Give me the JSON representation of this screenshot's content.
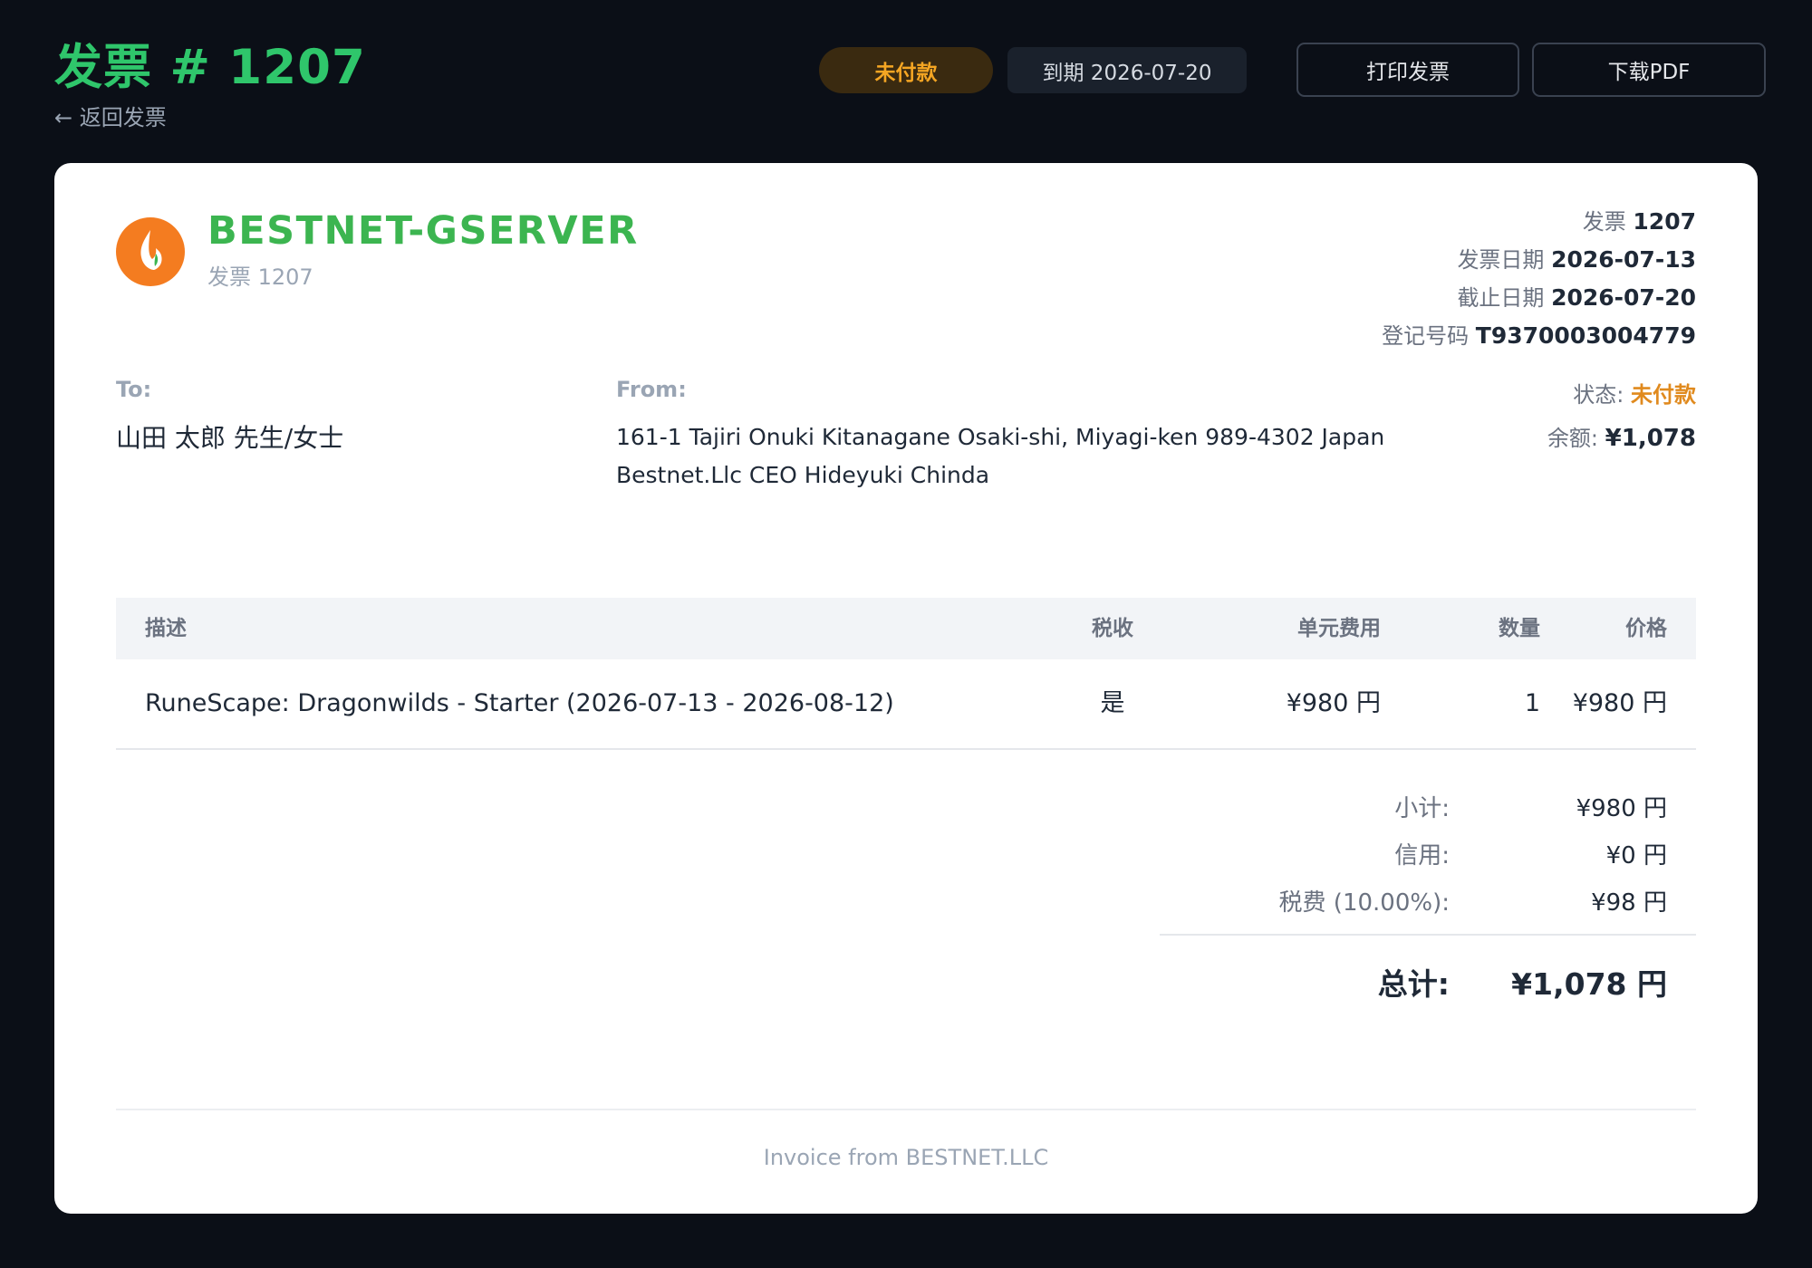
{
  "header": {
    "title": "发票 # 1207",
    "back_link": "← 返回发票",
    "status_badge": "未付款",
    "due_badge": "到期 2026-07-20",
    "print_button": "打印发票",
    "pdf_button": "下载PDF"
  },
  "company": {
    "name": "BESTNET-GSERVER",
    "subtitle": "发票 1207",
    "logo_color": "#f47c20",
    "name_color": "#3cb550"
  },
  "meta": {
    "invoice_label": "发票",
    "invoice_value": "1207",
    "date_label": "发票日期",
    "date_value": "2026-07-13",
    "due_label": "截止日期",
    "due_value": "2026-07-20",
    "reg_label": "登记号码",
    "reg_value": "T9370003004779"
  },
  "parties": {
    "to_label": "To:",
    "to_name": "山田 太郎 先生/女士",
    "from_label": "From:",
    "from_line1": "161-1 Tajiri Onuki Kitanagane Osaki-shi, Miyagi-ken 989-4302 Japan",
    "from_line2": "Bestnet.Llc CEO Hideyuki Chinda"
  },
  "status": {
    "status_label": "状态:",
    "status_value": "未付款",
    "balance_label": "余额:",
    "balance_value": "¥1,078"
  },
  "table": {
    "headers": {
      "description": "描述",
      "tax": "税收",
      "unit_cost": "单元费用",
      "quantity": "数量",
      "price": "价格"
    },
    "rows": [
      {
        "description": "RuneScape: Dragonwilds - Starter (2026-07-13 - 2026-08-12)",
        "tax": "是",
        "unit_cost": "¥980 円",
        "quantity": "1",
        "price": "¥980 円"
      }
    ]
  },
  "totals": {
    "subtotal_label": "小计:",
    "subtotal_value": "¥980 円",
    "credit_label": "信用:",
    "credit_value": "¥0 円",
    "tax_label": "税费 (10.00%):",
    "tax_value": "¥98 円",
    "total_label": "总计:",
    "total_value": "¥1,078 円"
  },
  "footer": {
    "text": "Invoice from BESTNET.LLC"
  },
  "colors": {
    "accent_green": "#2fc66b",
    "status_orange": "#f5a623",
    "page_background": "#0b0f17"
  }
}
